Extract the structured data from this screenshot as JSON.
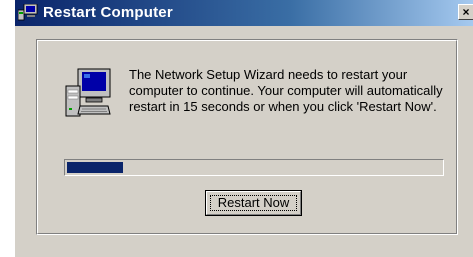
{
  "window": {
    "title": "Restart Computer",
    "close_glyph": "×"
  },
  "dialog": {
    "message": "The Network Setup Wizard needs to restart your computer to continue. Your computer will automatically restart in 15 seconds or when you click 'Restart Now'.",
    "progress_fraction": 0.15,
    "restart_button_label": "Restart Now"
  },
  "icons": {
    "title_icon": "network-computer-icon",
    "dialog_icon": "computer-restart-icon"
  },
  "colors": {
    "titlebar_start": "#0a246a",
    "titlebar_end": "#a6caf0",
    "dialog_face": "#d4d0c8",
    "progress_fill": "#0a246a"
  }
}
